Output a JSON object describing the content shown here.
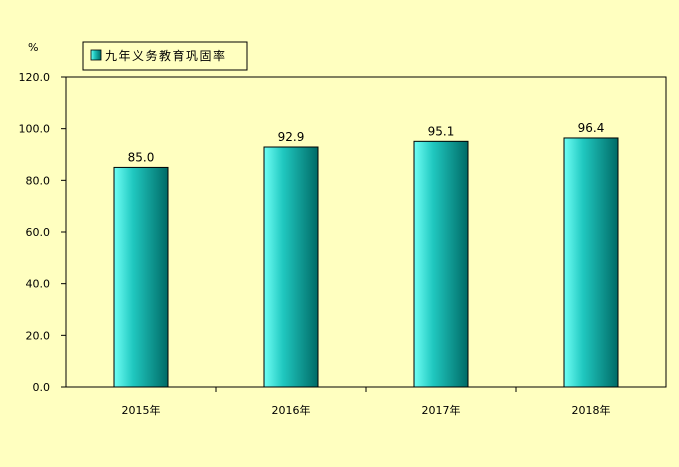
{
  "chart_data": {
    "type": "bar",
    "unit": "%",
    "categories": [
      "2015年",
      "2016年",
      "2017年",
      "2018年"
    ],
    "series": [
      {
        "name": "九年义务教育巩固率",
        "values": [
          85.0,
          92.9,
          95.1,
          96.4
        ]
      }
    ],
    "data_labels": [
      "85.0",
      "92.9",
      "95.1",
      "96.4"
    ],
    "y_ticks": [
      "0.0",
      "20.0",
      "40.0",
      "60.0",
      "80.0",
      "100.0",
      "120.0"
    ],
    "ylim": [
      0,
      120
    ],
    "grid": false,
    "legend_position": "top-left",
    "colors": {
      "background": "#FFFFC0",
      "plot_background": "#FFFFC0",
      "bar_light": "#6FFFF5",
      "bar_mid": "#20C8C0",
      "bar_dark": "#006A66"
    }
  }
}
